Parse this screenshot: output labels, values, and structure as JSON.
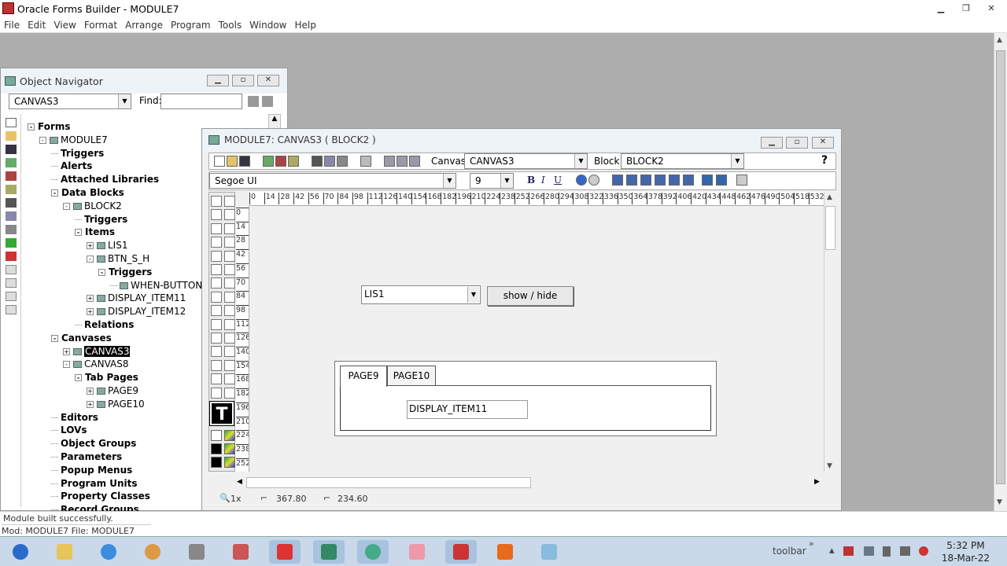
{
  "app": {
    "title": "Oracle Forms Builder - MODULE7",
    "menu": [
      "File",
      "Edit",
      "View",
      "Format",
      "Arrange",
      "Program",
      "Tools",
      "Window",
      "Help"
    ]
  },
  "navigator": {
    "title": "Object Navigator",
    "combo": "CANVAS3",
    "find_label": "Find:",
    "find_value": ""
  },
  "tree": [
    {
      "label": "Forms",
      "b": true,
      "lvl": 0,
      "exp": "-"
    },
    {
      "label": "MODULE7",
      "b": false,
      "lvl": 1,
      "exp": "-",
      "ico": true
    },
    {
      "label": "Triggers",
      "b": true,
      "lvl": 2
    },
    {
      "label": "Alerts",
      "b": true,
      "lvl": 2
    },
    {
      "label": "Attached Libraries",
      "b": true,
      "lvl": 2
    },
    {
      "label": "Data Blocks",
      "b": true,
      "lvl": 2,
      "exp": "-"
    },
    {
      "label": "BLOCK2",
      "b": false,
      "lvl": 3,
      "exp": "-",
      "ico": true
    },
    {
      "label": "Triggers",
      "b": true,
      "lvl": 4
    },
    {
      "label": "Items",
      "b": true,
      "lvl": 4,
      "exp": "-"
    },
    {
      "label": "LIS1",
      "b": false,
      "lvl": 5,
      "exp": "+",
      "ico": true
    },
    {
      "label": "BTN_S_H",
      "b": false,
      "lvl": 5,
      "exp": "-",
      "ico": true
    },
    {
      "label": "Triggers",
      "b": true,
      "lvl": 6,
      "exp": "-"
    },
    {
      "label": "WHEN-BUTTON-",
      "b": false,
      "lvl": 7,
      "ico": true
    },
    {
      "label": "DISPLAY_ITEM11",
      "b": false,
      "lvl": 5,
      "exp": "+",
      "ico": true
    },
    {
      "label": "DISPLAY_ITEM12",
      "b": false,
      "lvl": 5,
      "exp": "+",
      "ico": true
    },
    {
      "label": "Relations",
      "b": true,
      "lvl": 4
    },
    {
      "label": "Canvases",
      "b": true,
      "lvl": 2,
      "exp": "-"
    },
    {
      "label": "CANVAS3",
      "b": false,
      "lvl": 3,
      "exp": "+",
      "ico": true,
      "sel": true
    },
    {
      "label": "CANVAS8",
      "b": false,
      "lvl": 3,
      "exp": "-",
      "ico": true
    },
    {
      "label": "Tab Pages",
      "b": true,
      "lvl": 4,
      "exp": "-"
    },
    {
      "label": "PAGE9",
      "b": false,
      "lvl": 5,
      "exp": "+",
      "ico": true
    },
    {
      "label": "PAGE10",
      "b": false,
      "lvl": 5,
      "exp": "+",
      "ico": true
    },
    {
      "label": "Editors",
      "b": true,
      "lvl": 2
    },
    {
      "label": "LOVs",
      "b": true,
      "lvl": 2
    },
    {
      "label": "Object Groups",
      "b": true,
      "lvl": 2
    },
    {
      "label": "Parameters",
      "b": true,
      "lvl": 2
    },
    {
      "label": "Popup Menus",
      "b": true,
      "lvl": 2
    },
    {
      "label": "Program Units",
      "b": true,
      "lvl": 2
    },
    {
      "label": "Property Classes",
      "b": true,
      "lvl": 2
    },
    {
      "label": "Record Groups",
      "b": true,
      "lvl": 2
    }
  ],
  "canvas_window": {
    "title": "MODULE7: CANVAS3 ( BLOCK2 )",
    "canvas_label": "Canvas:",
    "canvas_value": "CANVAS3",
    "block_label": "Block:",
    "block_value": "BLOCK2",
    "font": "Segoe UI",
    "size": "9",
    "help": "?",
    "ruler_h": [
      "0",
      "14",
      "28",
      "42",
      "56",
      "70",
      "84",
      "98",
      "112",
      "126",
      "140",
      "154",
      "168",
      "182",
      "196",
      "210",
      "224",
      "238",
      "252",
      "266",
      "280",
      "294",
      "308",
      "322",
      "336",
      "350",
      "364",
      "378",
      "392",
      "406",
      "420",
      "434",
      "448",
      "462",
      "476",
      "490",
      "504",
      "518",
      "532"
    ],
    "ruler_v": [
      "0",
      "14",
      "28",
      "42",
      "56",
      "70",
      "84",
      "98",
      "112",
      "126",
      "140",
      "154",
      "168",
      "182",
      "196",
      "210",
      "224",
      "238",
      "252"
    ],
    "zoom": "1x",
    "x_coord": "367.80",
    "y_coord": "234.60"
  },
  "items": {
    "list": "LIS1",
    "button": "show / hide",
    "tab1": "PAGE9",
    "tab2": "PAGE10",
    "display": "DISPLAY_ITEM11"
  },
  "status": {
    "message": "Module built successfully.",
    "file": "Mod: MODULE7 File: MODULE7"
  },
  "taskbar": {
    "toolbar": "toolbar",
    "time": "5:32 PM",
    "date": "18-Mar-22"
  }
}
